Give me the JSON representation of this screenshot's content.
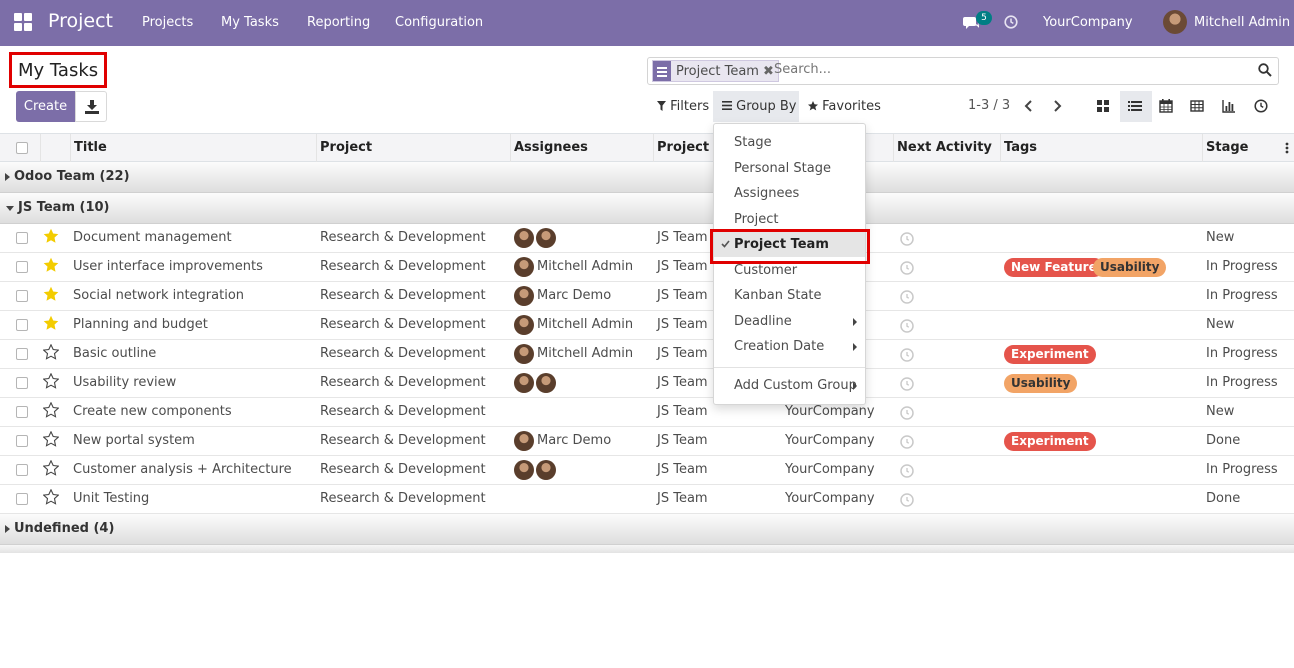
{
  "navbar": {
    "brand": "Project",
    "menus": [
      "Projects",
      "My Tasks",
      "Reporting",
      "Configuration"
    ],
    "chat_count": "5",
    "company": "YourCompany",
    "user": "Mitchell Admin"
  },
  "page": {
    "title": "My Tasks",
    "create_label": "Create"
  },
  "search": {
    "facet_value": "Project Team",
    "facet_remove": "✖",
    "placeholder": "Search..."
  },
  "filters": {
    "filters_label": "Filters",
    "groupby_label": "Group By",
    "favorites_label": "Favorites"
  },
  "pager": {
    "value": "1-3 / 3"
  },
  "columns": [
    "Title",
    "Project",
    "Assignees",
    "Project Te",
    "Next Activity",
    "Tags",
    "Stage"
  ],
  "groups": [
    {
      "label": "Odoo Team (22)"
    },
    {
      "label": "JS Team (10)"
    },
    {
      "label": "Undefined (4)"
    }
  ],
  "rows": [
    {
      "title": "Document management",
      "starred": true,
      "project": "Research & Development",
      "assignee_name": "",
      "team": "JS Team",
      "customer": "",
      "tags": [],
      "stage": "New"
    },
    {
      "title": "User interface improvements",
      "starred": true,
      "project": "Research & Development",
      "assignee_name": "Mitchell Admin",
      "team": "JS Team",
      "customer": "",
      "tags": [
        "New Feature",
        "Usability"
      ],
      "stage": "In Progress"
    },
    {
      "title": "Social network integration",
      "starred": true,
      "project": "Research & Development",
      "assignee_name": "Marc Demo",
      "team": "JS Team",
      "customer": "",
      "tags": [],
      "stage": "In Progress"
    },
    {
      "title": "Planning and budget",
      "starred": true,
      "project": "Research & Development",
      "assignee_name": "Mitchell Admin",
      "team": "JS Team",
      "customer": "",
      "tags": [],
      "stage": "New"
    },
    {
      "title": "Basic outline",
      "starred": false,
      "project": "Research & Development",
      "assignee_name": "Mitchell Admin",
      "team": "JS Team",
      "customer": "",
      "tags": [
        "Experiment"
      ],
      "stage": "In Progress"
    },
    {
      "title": "Usability review",
      "starred": false,
      "project": "Research & Development",
      "assignee_name": "",
      "team": "JS Team",
      "customer": "",
      "tags": [
        "Usability"
      ],
      "stage": "In Progress"
    },
    {
      "title": "Create new components",
      "starred": false,
      "project": "Research & Development",
      "assignee_name": "",
      "team": "JS Team",
      "customer": "YourCompany",
      "tags": [],
      "stage": "New"
    },
    {
      "title": "New portal system",
      "starred": false,
      "project": "Research & Development",
      "assignee_name": "Marc Demo",
      "team": "JS Team",
      "customer": "YourCompany",
      "tags": [
        "Experiment"
      ],
      "stage": "Done"
    },
    {
      "title": "Customer analysis + Architecture",
      "starred": false,
      "project": "Research & Development",
      "assignee_name": "",
      "team": "JS Team",
      "customer": "YourCompany",
      "tags": [],
      "stage": "In Progress"
    },
    {
      "title": "Unit Testing",
      "starred": false,
      "project": "Research & Development",
      "assignee_name": "",
      "team": "JS Team",
      "customer": "YourCompany",
      "tags": [],
      "stage": "Done"
    }
  ],
  "groupby_menu": {
    "items": [
      "Stage",
      "Personal Stage",
      "Assignees",
      "Project",
      "Project Team",
      "Customer",
      "Kanban State",
      "Deadline",
      "Creation Date"
    ],
    "selected": "Project Team",
    "custom_group": "Add Custom Group"
  },
  "colors": {
    "brand": "#7c6ea8",
    "tag_red": "#e5544b",
    "tag_orange": "#f2a466",
    "badge": "#017e84",
    "highlight": "#e00000"
  }
}
